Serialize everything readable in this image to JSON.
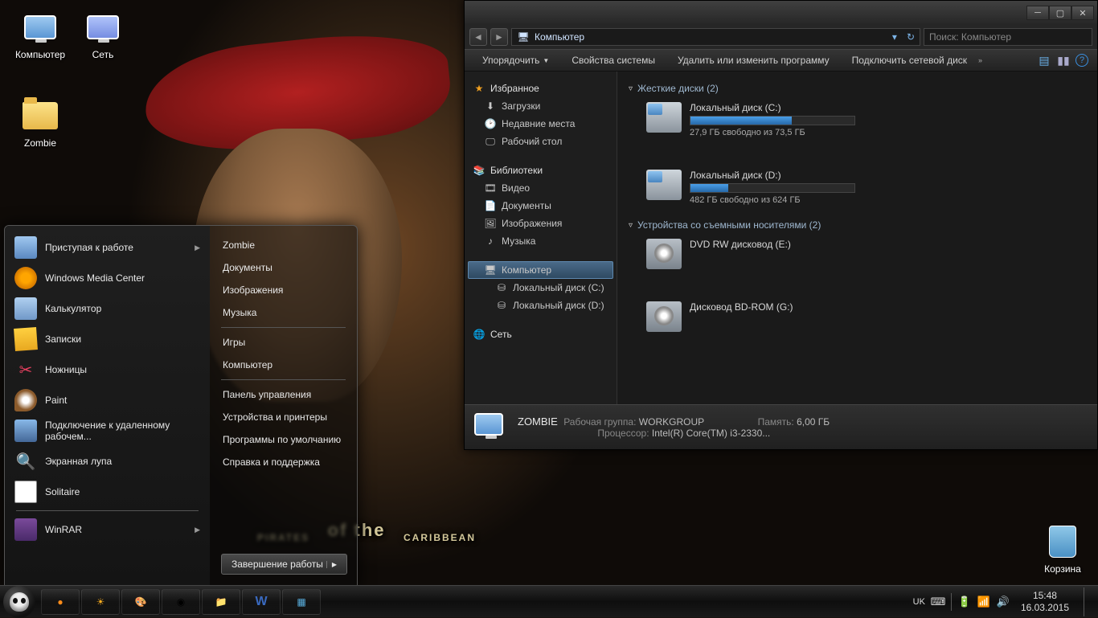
{
  "desktop": {
    "icons": [
      {
        "label": "Компьютер"
      },
      {
        "label": "Сеть"
      },
      {
        "label": "Zombie"
      },
      {
        "label": "Корзина"
      }
    ]
  },
  "wallpaper_title": {
    "a": "PIRATES",
    "b": "of the",
    "c": "CARIBBEAN"
  },
  "explorer": {
    "nav_location": "Компьютер",
    "search_placeholder": "Поиск: Компьютер",
    "toolbar": {
      "organize": "Упорядочить",
      "sysprops": "Свойства системы",
      "uninstall": "Удалить или изменить программу",
      "mapdrive": "Подключить сетевой диск"
    },
    "side": {
      "favorites": "Избранное",
      "downloads": "Загрузки",
      "recent": "Недавние места",
      "desktop": "Рабочий стол",
      "libraries": "Библиотеки",
      "video": "Видео",
      "documents": "Документы",
      "pictures": "Изображения",
      "music": "Музыка",
      "computer": "Компьютер",
      "drive_c": "Локальный диск (C:)",
      "drive_d": "Локальный диск (D:)",
      "network": "Сеть"
    },
    "cat_hdd": "Жесткие диски (2)",
    "cat_rem": "Устройства со съемными носителями (2)",
    "drives": {
      "c": {
        "name": "Локальный диск (C:)",
        "free": "27,9 ГБ свободно из 73,5 ГБ",
        "fill": 62
      },
      "d": {
        "name": "Локальный диск (D:)",
        "free": "482 ГБ свободно из 624 ГБ",
        "fill": 23
      },
      "e": {
        "name": "DVD RW дисковод (E:)"
      },
      "g": {
        "name": "Дисковод BD-ROM (G:)"
      }
    },
    "details": {
      "name": "ZOMBIE",
      "wg_l": "Рабочая группа:",
      "wg_v": "WORKGROUP",
      "mem_l": "Память:",
      "mem_v": "6,00 ГБ",
      "cpu_l": "Процессор:",
      "cpu_v": "Intel(R) Core(TM) i3-2330..."
    }
  },
  "start": {
    "left": [
      "Приступая к работе",
      "Windows Media Center",
      "Калькулятор",
      "Записки",
      "Ножницы",
      "Paint",
      "Подключение к удаленному рабочем...",
      "Экранная лупа",
      "Solitaire",
      "WinRAR"
    ],
    "right": [
      "Zombie",
      "Документы",
      "Изображения",
      "Музыка",
      "Игры",
      "Компьютер",
      "Панель управления",
      "Устройства и принтеры",
      "Программы по умолчанию",
      "Справка и поддержка"
    ],
    "shutdown": "Завершение работы"
  },
  "taskbar": {
    "lang": "UK",
    "time": "15:48",
    "date": "16.03.2015"
  }
}
